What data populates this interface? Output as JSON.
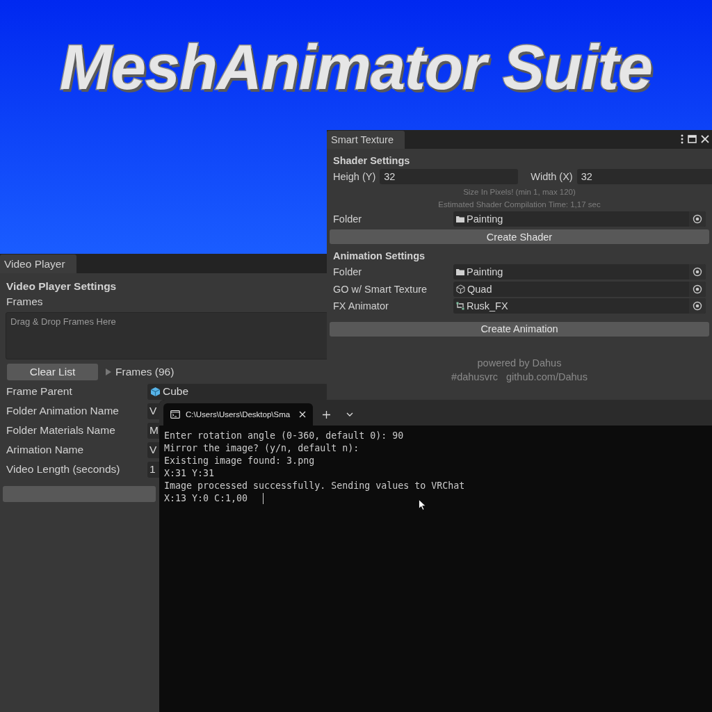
{
  "banner": {
    "title": "MeshAnimator Suite"
  },
  "smart_texture": {
    "tab": "Smart Texture",
    "shader_settings": {
      "heading": "Shader Settings",
      "height_label": "Heigh (Y)",
      "height_value": "32",
      "width_label": "Width (X)",
      "width_value": "32",
      "hints": [
        "Size In Pixels! (min 1, max 120)",
        "Estimated Shader Compilation Time: 1,17 sec"
      ],
      "folder": {
        "label": "Folder",
        "value": "Painting",
        "kind": "folder"
      },
      "button": "Create Shader"
    },
    "animation_settings": {
      "heading": "Animation Settings",
      "fields": [
        {
          "label": "Folder",
          "value": "Painting",
          "kind": "folder"
        },
        {
          "label": "GO w/ Smart Texture",
          "value": "Quad",
          "kind": "mesh"
        },
        {
          "label": "FX Animator",
          "value": "Rusk_FX",
          "kind": "animator"
        }
      ],
      "button": "Create Animation"
    },
    "footer": {
      "credit": "powered by Dahus",
      "links": [
        "#dahusvrc",
        "github.com/Dahus"
      ]
    }
  },
  "video_player": {
    "tab": "Video Player",
    "heading": "Video Player Settings",
    "frames_label": "Frames",
    "drop_hint": "Drag & Drop Frames Here",
    "clear_button": "Clear List",
    "frames_foldout": {
      "label": "Frames (96)",
      "expanded": false
    },
    "fields": [
      {
        "label": "Frame Parent",
        "value": "Cube",
        "kind": "gameobject"
      },
      {
        "label": "Folder Animation Name",
        "value": "V",
        "kind": "text"
      },
      {
        "label": "Folder Materials Name",
        "value": "M",
        "kind": "text"
      },
      {
        "label": "Arimation Name",
        "value": "V",
        "kind": "text"
      },
      {
        "label": "Video Length (seconds)",
        "value": "1",
        "kind": "text"
      }
    ]
  },
  "terminal": {
    "tab": "C:\\Users\\Users\\Desktop\\Sma",
    "lines": [
      "Enter rotation angle (0-360, default 0): 90",
      "Mirror the image? (y/n, default n):",
      "Existing image found: 3.png",
      "X:31 Y:31",
      "Image processed successfully. Sending values to VRChat",
      "X:13 Y:0 C:1,00"
    ]
  }
}
